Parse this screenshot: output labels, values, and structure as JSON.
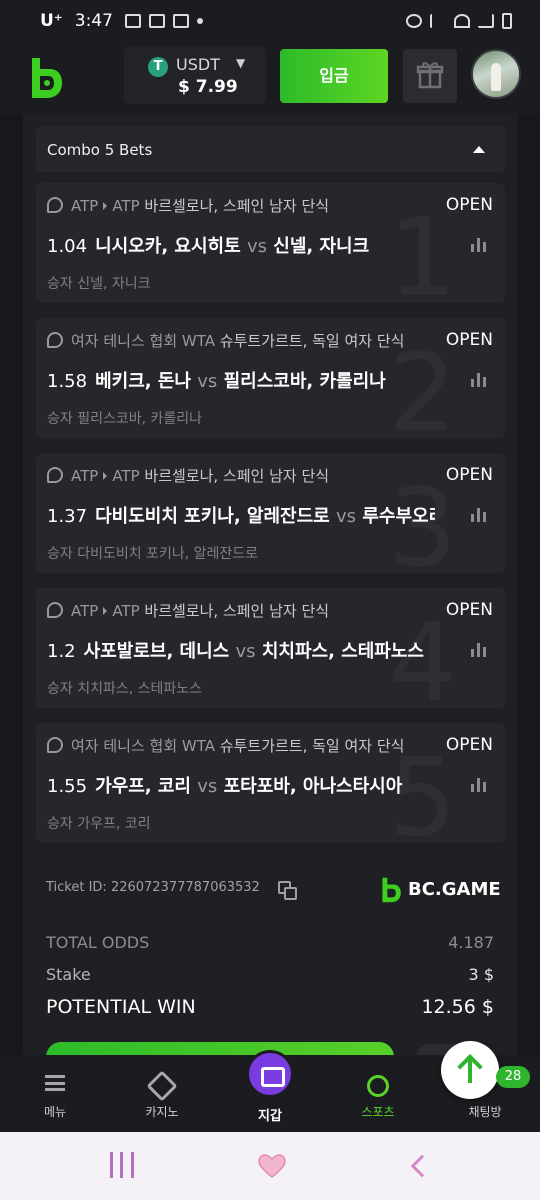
{
  "status_bar": {
    "carrier": "U⁺",
    "time": "3:47"
  },
  "header": {
    "currency": "USDT",
    "balance": "$ 7.99",
    "deposit_label": "입금"
  },
  "combo": {
    "title": "Combo 5 Bets"
  },
  "bets": [
    {
      "league_prefix": "ATP",
      "league_org": "ATP",
      "league_event": "바르셀로나, 스페인 남자 단식",
      "status": "OPEN",
      "odds": "1.04",
      "team1": "니시오카, 요시히토",
      "vs": "vs",
      "team2": "신넬, 자니크",
      "winner": "승자 신넬, 자니크",
      "index": "1"
    },
    {
      "league_prefix": "여자 테니스 협회",
      "league_org": "WTA",
      "league_event": "슈투트가르트, 독일 여자 단식",
      "status": "OPEN",
      "odds": "1.58",
      "team1": "베키크, 돈나",
      "vs": "vs",
      "team2": "필리스코바, 카롤리나",
      "winner": "승자 필리스코바, 카롤리나",
      "index": "2"
    },
    {
      "league_prefix": "ATP",
      "league_org": "ATP",
      "league_event": "바르셀로나, 스페인 남자 단식",
      "status": "OPEN",
      "odds": "1.37",
      "team1": "다비도비치 포키나, 알레잔드로",
      "vs": "vs",
      "team2": "루수부오리",
      "winner": "승자 다비도비치 포키나, 알레잔드로",
      "index": "3"
    },
    {
      "league_prefix": "ATP",
      "league_org": "ATP",
      "league_event": "바르셀로나, 스페인 남자 단식",
      "status": "OPEN",
      "odds": "1.2",
      "team1": "사포발로브, 데니스",
      "vs": "vs",
      "team2": "치치파스, 스테파노스",
      "winner": "승자 치치파스, 스테파노스",
      "index": "4"
    },
    {
      "league_prefix": "여자 테니스 협회",
      "league_org": "WTA",
      "league_event": "슈투트가르트, 독일 여자 단식",
      "status": "OPEN",
      "odds": "1.55",
      "team1": "가우프, 코리",
      "vs": "vs",
      "team2": "포타포바, 아나스타시아",
      "winner": "승자 가우프, 코리",
      "index": "5"
    }
  ],
  "ticket": {
    "id_text": "Ticket ID: 226072377787063532",
    "brand": "BC.GAME",
    "total_odds_label": "TOTAL ODDS",
    "total_odds_value": "4.187",
    "stake_label": "Stake",
    "stake_value": "3 $",
    "potential_win_label": "POTENTIAL WIN",
    "potential_win_value": "12.56 $"
  },
  "bottom_nav": {
    "menu": "메뉴",
    "casino": "카지노",
    "wallet": "지갑",
    "sports": "스포츠",
    "chat": "채팅방",
    "chat_badge": "28"
  },
  "colors": {
    "accent_green": "#2dbb2a",
    "wallet_purple": "#7a3ce0",
    "usdt_green": "#26a17b"
  }
}
